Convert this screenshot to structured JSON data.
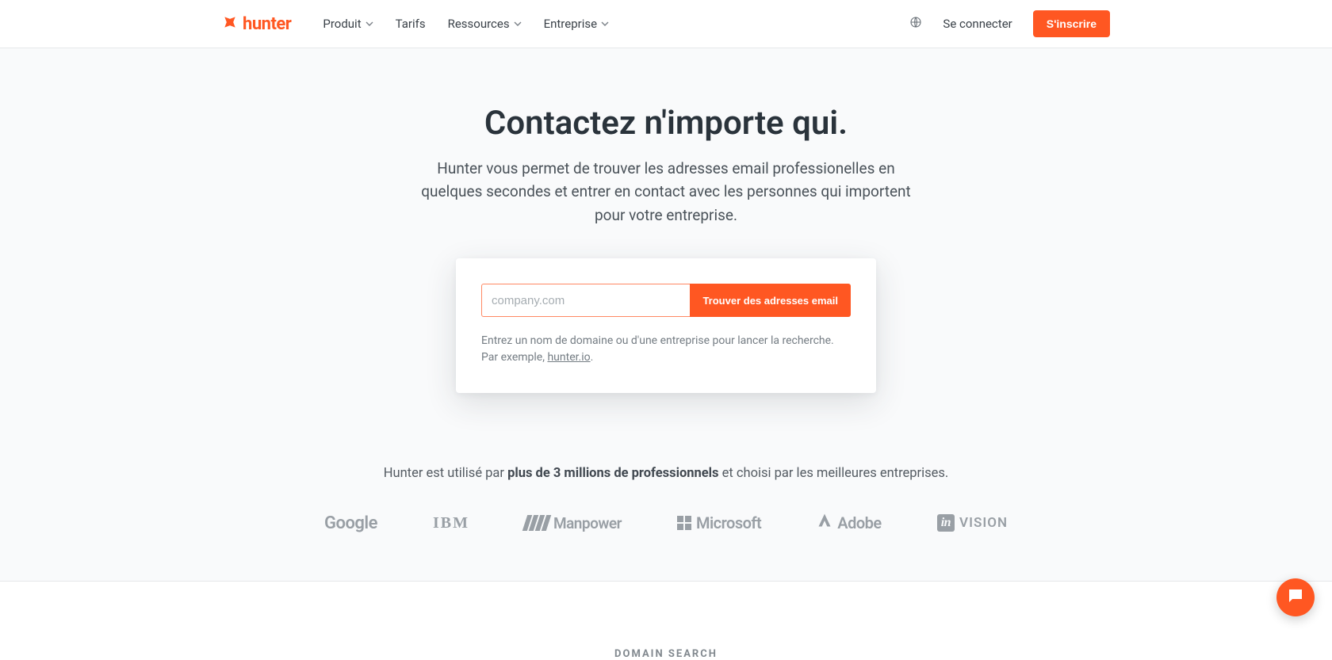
{
  "brand": {
    "name": "hunter"
  },
  "nav": {
    "items": [
      {
        "label": "Produit",
        "dropdown": true
      },
      {
        "label": "Tarifs",
        "dropdown": false
      },
      {
        "label": "Ressources",
        "dropdown": true
      },
      {
        "label": "Entreprise",
        "dropdown": true
      }
    ],
    "login": "Se connecter",
    "signup": "S'inscrire"
  },
  "hero": {
    "title": "Contactez n'importe qui.",
    "subtitle": "Hunter vous permet de trouver les adresses email professionelles en quelques secondes et entrer en contact avec les personnes qui importent pour votre entreprise."
  },
  "search": {
    "placeholder": "company.com",
    "button": "Trouver des adresses email",
    "hint_prefix": "Entrez un nom de domaine ou d'une entreprise pour lancer la recherche. Par exemple, ",
    "hint_link": "hunter.io",
    "hint_suffix": "."
  },
  "social": {
    "text_before": "Hunter est utilisé par ",
    "text_strong": "plus de 3 millions de professionnels",
    "text_after": " et choisi par les meilleures entreprises.",
    "brands": {
      "google": "Google",
      "ibm": "IBM",
      "manpower": "Manpower",
      "microsoft": "Microsoft",
      "adobe": "Adobe",
      "invision": "VISION",
      "invision_prefix": "in"
    }
  },
  "section": {
    "domain_search": "DOMAIN SEARCH"
  },
  "colors": {
    "accent": "#ff5722"
  }
}
